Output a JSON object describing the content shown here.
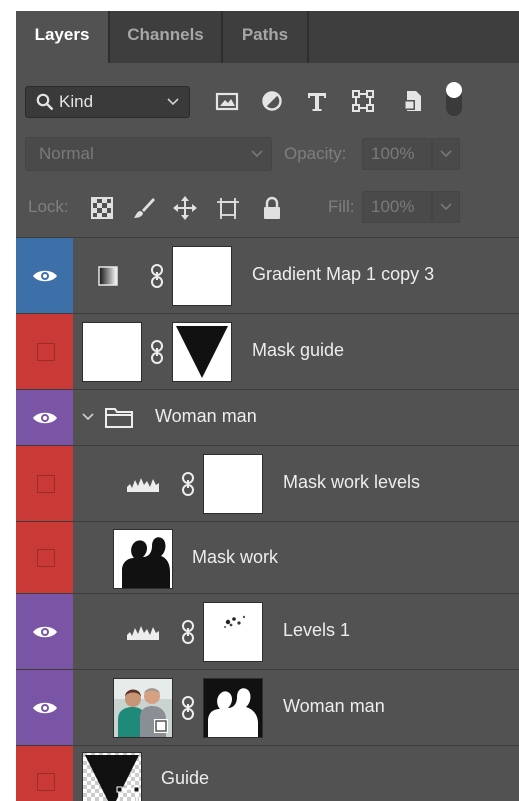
{
  "tabs": [
    {
      "label": "Layers",
      "active": true
    },
    {
      "label": "Channels",
      "active": false
    },
    {
      "label": "Paths",
      "active": false
    }
  ],
  "filter": {
    "kind_label": "Kind",
    "icons": [
      "image-filter-icon",
      "adjustment-filter-icon",
      "type-filter-icon",
      "shape-filter-icon",
      "smart-object-filter-icon",
      "filter-toggle-icon"
    ]
  },
  "blend": {
    "mode": "Normal",
    "opacity_label": "Opacity:",
    "opacity_value": "100%"
  },
  "lock": {
    "label": "Lock:",
    "fill_label": "Fill:",
    "fill_value": "100%",
    "icons": [
      "lock-transparent-pixels-icon",
      "lock-image-pixels-icon",
      "lock-position-icon",
      "lock-artboard-icon",
      "lock-all-icon"
    ]
  },
  "layers": [
    {
      "name": "Gradient Map 1 copy 3",
      "visible": true,
      "color": "#3d70a9",
      "kind": "gradient-map"
    },
    {
      "name": "Mask guide",
      "visible": false,
      "color": "#c93a37",
      "kind": "mask-guide"
    },
    {
      "name": "Woman man",
      "visible": true,
      "color": "#7a55a5",
      "kind": "group",
      "expanded": true
    },
    {
      "name": "Mask work levels",
      "visible": false,
      "color": "#c93a37",
      "kind": "levels",
      "indent": 1
    },
    {
      "name": "Mask work",
      "visible": false,
      "color": "#c93a37",
      "kind": "silhouette",
      "indent": 1
    },
    {
      "name": "Levels 1",
      "visible": true,
      "color": "#7a55a5",
      "kind": "levels-mask",
      "indent": 1
    },
    {
      "name": "Woman man",
      "visible": true,
      "color": "#7a55a5",
      "kind": "photo-with-mask",
      "indent": 1
    },
    {
      "name": "Guide",
      "visible": false,
      "color": "#c93a37",
      "kind": "guide-shape"
    }
  ],
  "colors": {
    "panel": "#525252",
    "tabbar": "#3e3e3e",
    "blue_label": "#3d70a9",
    "red_label": "#c93a37",
    "violet_label": "#7a55a5"
  }
}
